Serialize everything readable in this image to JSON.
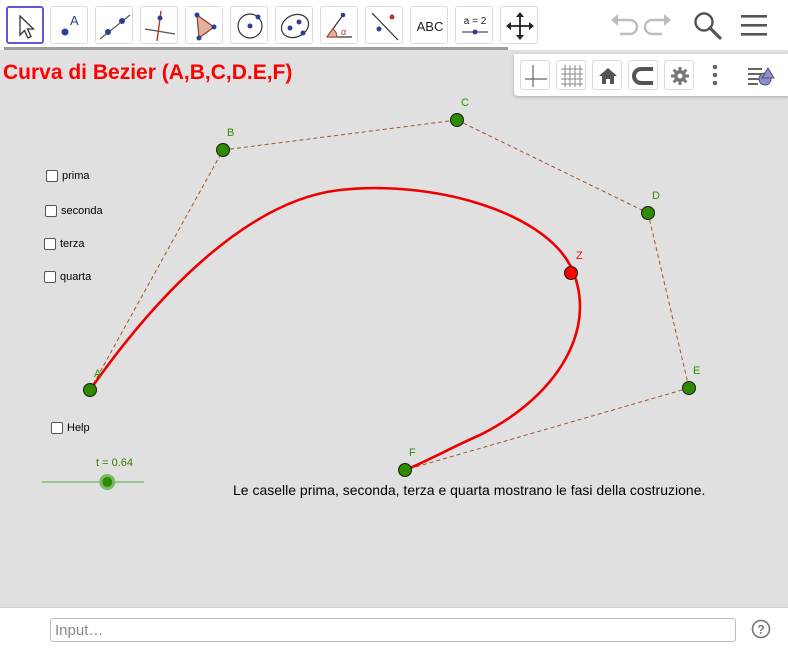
{
  "toolbar": {
    "tools": [
      {
        "name": "move-tool",
        "icon": "arrow-pointer-icon",
        "active": true
      },
      {
        "name": "point-tool",
        "icon": "point-A-icon",
        "label": "A"
      },
      {
        "name": "line-tool",
        "icon": "line-through-points-icon"
      },
      {
        "name": "perpendicular-tool",
        "icon": "perpendicular-line-icon"
      },
      {
        "name": "polygon-tool",
        "icon": "polygon-icon"
      },
      {
        "name": "circle-tool",
        "icon": "circle-center-point-icon"
      },
      {
        "name": "ellipse-tool",
        "icon": "ellipse-icon"
      },
      {
        "name": "angle-tool",
        "icon": "angle-icon",
        "label": "α"
      },
      {
        "name": "reflect-tool",
        "icon": "reflect-line-icon"
      },
      {
        "name": "text-tool",
        "icon": "text-icon",
        "label": "ABC"
      },
      {
        "name": "slider-tool",
        "icon": "slider-icon",
        "label": "a = 2"
      },
      {
        "name": "move-view-tool",
        "icon": "move-arrows-icon"
      }
    ],
    "undo_icon": "undo-icon",
    "redo_icon": "redo-icon",
    "search_icon": "search-icon",
    "menu_icon": "hamburger-menu-icon"
  },
  "graphics_bar": {
    "buttons": [
      "axes-icon",
      "grid-icon",
      "home-icon",
      "magnet-icon",
      "gear-icon",
      "more-vertical-icon",
      "style-bar-toggle-icon"
    ]
  },
  "title": "Curva di Bezier (A,B,C,D.E,F)",
  "checkboxes": [
    {
      "label": "prima",
      "checked": false
    },
    {
      "label": "seconda",
      "checked": false
    },
    {
      "label": "terza",
      "checked": false
    },
    {
      "label": "quarta",
      "checked": false
    },
    {
      "label": "Help",
      "checked": false
    }
  ],
  "slider": {
    "label": "t = 0.64",
    "value": 0.64
  },
  "points": [
    {
      "label": "A"
    },
    {
      "label": "B"
    },
    {
      "label": "C"
    },
    {
      "label": "D"
    },
    {
      "label": "E"
    },
    {
      "label": "F"
    },
    {
      "label": "Z"
    }
  ],
  "description": "Le caselle prima, seconda, terza e quarta mostrano le fasi della costruzione.",
  "input_bar": {
    "placeholder": "Input…",
    "value": ""
  },
  "help_icon": "help-circle-icon",
  "colors": {
    "title": "#ff0000",
    "curve": "#ee0000",
    "point_fill": "#2e8b00",
    "point_label": "#2f8f00",
    "point_Z": "#ff0000",
    "polygon_dash": "#a0522d",
    "active_tool_border": "#6557d2"
  }
}
